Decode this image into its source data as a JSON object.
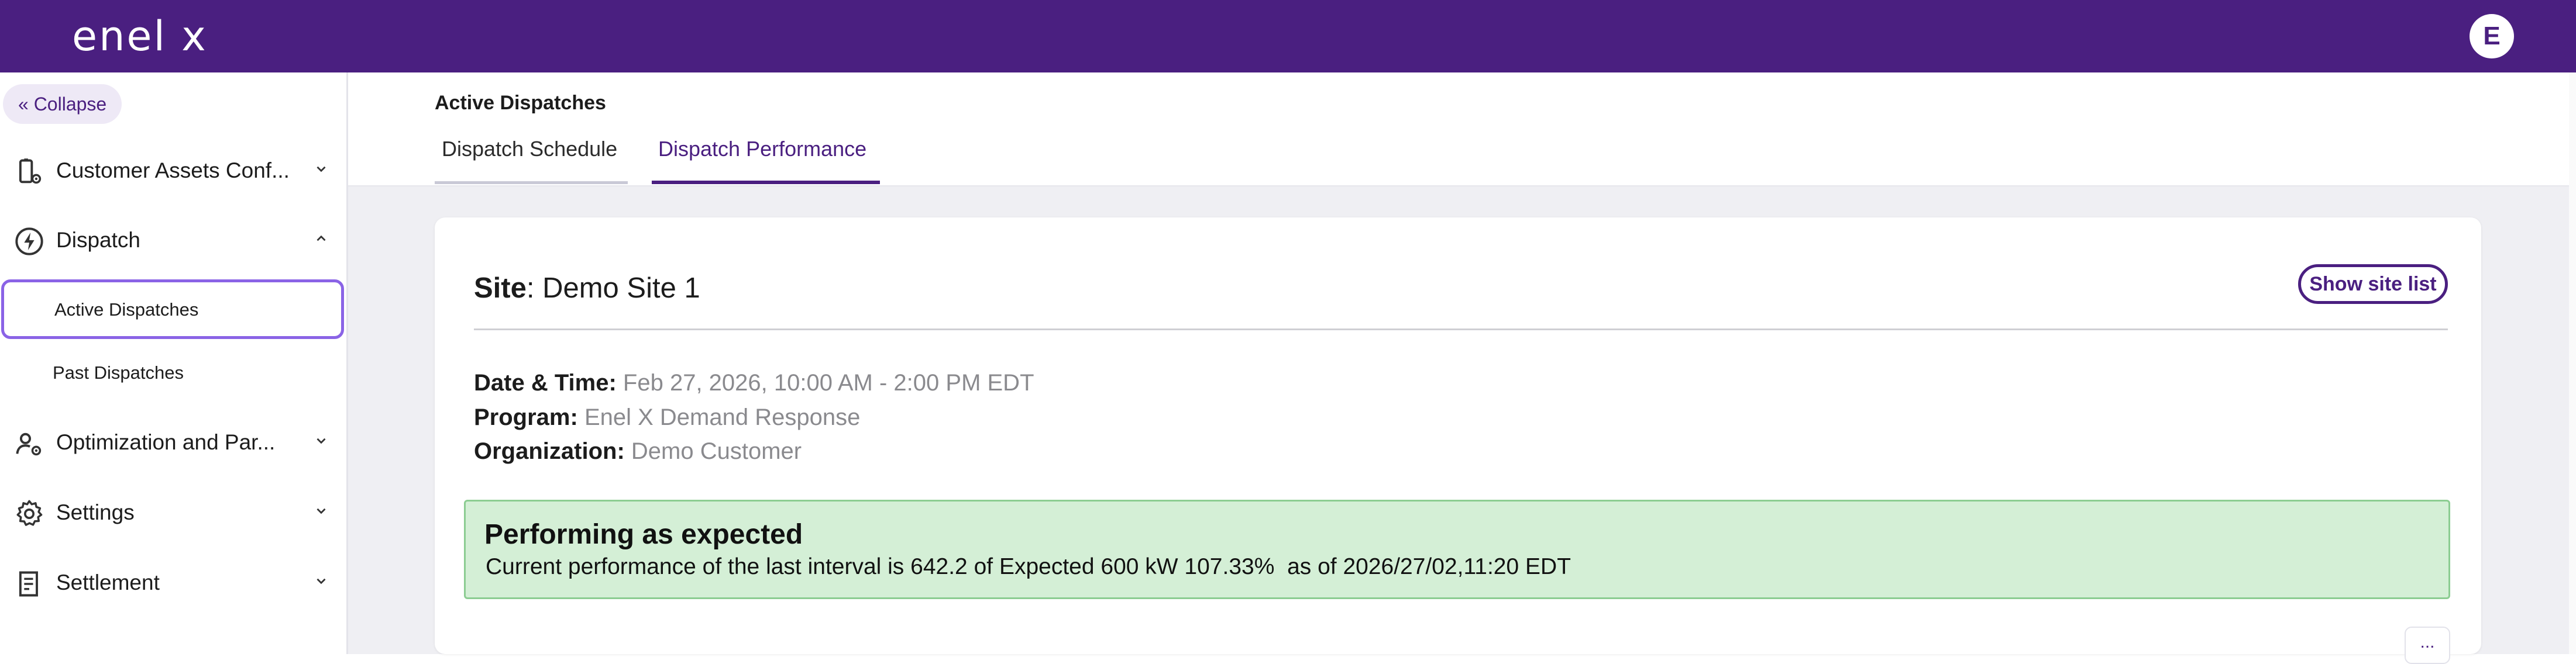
{
  "app": {
    "logo": "enel x",
    "avatar_initial": "E",
    "brand_color": "#4a1f80"
  },
  "sidebar": {
    "collapse_label": "Collapse",
    "items": [
      {
        "label": "Customer Assets Conf...",
        "icon": "asset-config-icon",
        "chevron": "chevron-down"
      },
      {
        "label": "Dispatch",
        "icon": "lightning-icon",
        "chevron": "chevron-up",
        "children": [
          {
            "label": "Active Dispatches",
            "active": true
          },
          {
            "label": "Past Dispatches",
            "active": false
          }
        ]
      },
      {
        "label": "Optimization and Par...",
        "icon": "user-settings-icon",
        "chevron": "chevron-down"
      },
      {
        "label": "Settings",
        "icon": "gear-icon",
        "chevron": "chevron-down"
      },
      {
        "label": "Settlement",
        "icon": "receipt-icon",
        "chevron": "chevron-down"
      }
    ]
  },
  "header": {
    "title": "Active Dispatches",
    "tabs": [
      {
        "label": "Dispatch Schedule",
        "active": false
      },
      {
        "label": "Dispatch Performance",
        "active": true
      }
    ]
  },
  "card": {
    "site_label": "Site",
    "site_value": ": Demo Site 1",
    "show_site_list": "Show site list",
    "details": [
      {
        "key": "Date & Time:",
        "value": "Feb 27, 2026, 10:00 AM - 2:00 PM EDT"
      },
      {
        "key": "Program:",
        "value": "Enel X Demand Response"
      },
      {
        "key": "Organization:",
        "value": "Demo Customer"
      }
    ],
    "performance": {
      "title": "Performing as expected",
      "message": "Current performance of the last interval is 642.2 of Expected 600 kW 107.33%  as of 2026/27/02,11:20 EDT",
      "status_color": "#d4efd6"
    },
    "more_label": "..."
  }
}
